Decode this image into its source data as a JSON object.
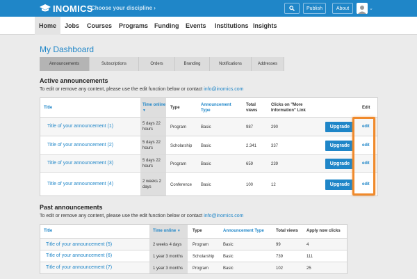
{
  "topbar": {
    "logo": "INOMICS",
    "discipline": "Choose your discipline ›",
    "publish": "Publish",
    "about": "About"
  },
  "nav": [
    "Home",
    "Jobs",
    "Courses",
    "Programs",
    "Funding",
    "Events",
    "Institutions",
    "Insights"
  ],
  "dashboard": {
    "title": "My Dashboard",
    "tabs": [
      "Announcements",
      "Subscriptions",
      "Orders",
      "Branding",
      "Notifications",
      "Addresses"
    ]
  },
  "active": {
    "heading": "Active announcements",
    "hint": "To edit or remove any content, please use the edit function below or contact ",
    "email": "info@inomics.com",
    "headers": {
      "title": "Title",
      "time": "Time online",
      "type": "Type",
      "atype": "Announcement Type",
      "views": "Total views",
      "clicks": "Clicks on \"More Information\" Link",
      "edit": "Edit"
    },
    "rows": [
      {
        "title": "Title of your announcement (1)",
        "time": "5 days 22 hours",
        "type": "Program",
        "atype": "Basic",
        "views": "987",
        "clicks": "290",
        "upgrade": "Upgrade",
        "edit": "edit"
      },
      {
        "title": "Title of your announcement (2)",
        "time": "5 days 22 hours",
        "type": "Scholarship",
        "atype": "Basic",
        "views": "2.341",
        "clicks": "337",
        "upgrade": "Upgrade",
        "edit": "edit"
      },
      {
        "title": "Title of your announcement (3)",
        "time": "5 days 22 hours",
        "type": "Program",
        "atype": "Basic",
        "views": "659",
        "clicks": "239",
        "upgrade": "Upgrade",
        "edit": "edit"
      },
      {
        "title": "Title of your announcement (4)",
        "time": "2 weeks 2 days",
        "type": "Conference",
        "atype": "Basic",
        "views": "100",
        "clicks": "12",
        "upgrade": "Upgrade",
        "edit": "edit"
      }
    ]
  },
  "past": {
    "heading": "Past announcements",
    "hint": "To edit or remove any content, please use the edit function below or contact ",
    "email": "info@inomics.com",
    "headers": {
      "title": "Title",
      "time": "Time online",
      "type": "Type",
      "atype": "Announcement Type",
      "views": "Total views",
      "clicks": "Apply now clicks"
    },
    "rows": [
      {
        "title": "Title of your announcement (5)",
        "time": "2 weeks 4 days",
        "type": "Program",
        "atype": "Basic",
        "views": "99",
        "clicks": "4"
      },
      {
        "title": "Title of your announcement (6)",
        "time": "1 year 3 months",
        "type": "Scholarship",
        "atype": "Basic",
        "views": "739",
        "clicks": "111"
      },
      {
        "title": "Title of your announcement (7)",
        "time": "1 year 3 months",
        "type": "Program",
        "atype": "Basic",
        "views": "102",
        "clicks": "25"
      }
    ]
  }
}
